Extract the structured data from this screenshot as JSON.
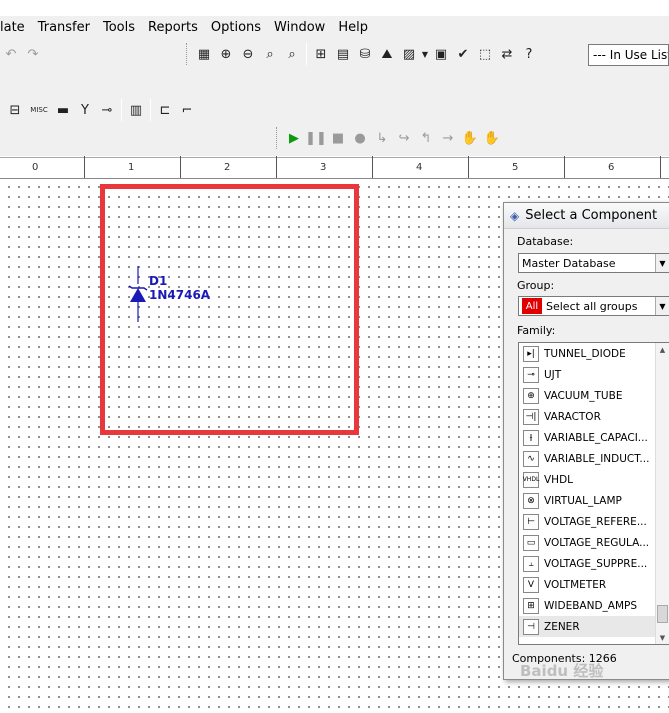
{
  "menu": [
    "late",
    "Transfer",
    "Tools",
    "Reports",
    "Options",
    "Window",
    "Help"
  ],
  "toolbar": {
    "in_use_list": "--- In Use List",
    "misc_label": "MISC"
  },
  "ruler": {
    "marks": [
      "0",
      "1",
      "2",
      "3",
      "4",
      "5",
      "6"
    ]
  },
  "schematic": {
    "ref": "D1",
    "part": "1N4746A",
    "highlight_color": "#e8383c"
  },
  "panel": {
    "title": "Select a Component",
    "database_label": "Database:",
    "database_value": "Master Database",
    "group_label": "Group:",
    "group_badge": "All",
    "group_value": "Select all groups",
    "family_label": "Family:",
    "families": [
      {
        "name": "TUNNEL_DIODE",
        "icon": "▸|"
      },
      {
        "name": "UJT",
        "icon": "⊸"
      },
      {
        "name": "VACUUM_TUBE",
        "icon": "⊕"
      },
      {
        "name": "VARACTOR",
        "icon": "⊣|"
      },
      {
        "name": "VARIABLE_CAPACI...",
        "icon": "⫲"
      },
      {
        "name": "VARIABLE_INDUCT...",
        "icon": "∿"
      },
      {
        "name": "VHDL",
        "icon": "VHDL"
      },
      {
        "name": "VIRTUAL_LAMP",
        "icon": "⊗"
      },
      {
        "name": "VOLTAGE_REFERE...",
        "icon": "⊢"
      },
      {
        "name": "VOLTAGE_REGULA...",
        "icon": "▭"
      },
      {
        "name": "VOLTAGE_SUPPRE...",
        "icon": "⫠"
      },
      {
        "name": "VOLTMETER",
        "icon": "V"
      },
      {
        "name": "WIDEBAND_AMPS",
        "icon": "⊞"
      },
      {
        "name": "ZENER",
        "icon": "⊣"
      }
    ],
    "status": "Components: 1266"
  },
  "watermark": "Baidu 经验"
}
